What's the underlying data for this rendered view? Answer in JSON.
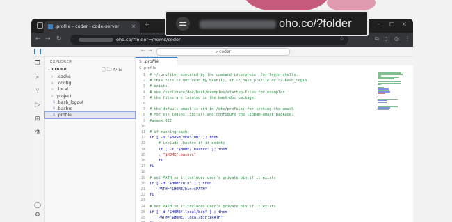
{
  "browser": {
    "tab_title": ".profile - coder - code-server",
    "tab_close": "×",
    "new_tab": "+",
    "url": "oho.co/?folder=/home/coder",
    "window_controls": [
      "–",
      "□",
      "×"
    ],
    "toolbar_icons": [
      "arrow-left-icon",
      "arrow-right-icon",
      "reload-icon",
      "tune-icon",
      "star-icon",
      "extensions-icon",
      "sidebar-icon",
      "profile-icon",
      "menu-icon"
    ]
  },
  "zoom_popup": {
    "url": "oho.co/?folder"
  },
  "vscode": {
    "command_center": "coder",
    "sidebar": {
      "header": "EXPLORER",
      "folder": "CODER",
      "items": [
        {
          "label": ".cache",
          "type": "folder"
        },
        {
          "label": ".config",
          "type": "folder"
        },
        {
          "label": ".local",
          "type": "folder"
        },
        {
          "label": "project",
          "type": "folder"
        },
        {
          "label": ".bash_logout",
          "type": "file"
        },
        {
          "label": ".bashrc",
          "type": "file"
        },
        {
          "label": ".profile",
          "type": "file",
          "selected": true
        }
      ]
    },
    "editor": {
      "tab_label": ".profile",
      "breadcrumb": ".profile",
      "lines": [
        {
          "n": "1",
          "t": "# ~/.profile: executed by the command interpreter for login shells.",
          "k": "comment"
        },
        {
          "n": "2",
          "t": "# This file is not read by bash(1), if ~/.bash_profile or ~/.bash_login",
          "k": "comment"
        },
        {
          "n": "3",
          "t": "# exists.",
          "k": "comment"
        },
        {
          "n": "4",
          "t": "# see /usr/share/doc/bash/examples/startup-files for examples.",
          "k": "comment"
        },
        {
          "n": "5",
          "t": "# the files are located in the bash-doc package.",
          "k": "comment"
        },
        {
          "n": "6",
          "t": "",
          "k": "plain"
        },
        {
          "n": "7",
          "t": "# the default umask is set in /etc/profile; for setting the umask",
          "k": "comment"
        },
        {
          "n": "8",
          "t": "# for ssh logins, install and configure the libpam-umask package.",
          "k": "comment"
        },
        {
          "n": "9",
          "t": "#umask 022",
          "k": "comment"
        },
        {
          "n": "10",
          "t": "",
          "k": "plain"
        },
        {
          "n": "11",
          "t": "# if running bash",
          "k": "comment"
        },
        {
          "n": "12",
          "t": "if [ -n \"$BASH_VERSION\" ]; then",
          "k": "kw"
        },
        {
          "n": "13",
          "t": "    # include .bashrc if it exists",
          "k": "comment"
        },
        {
          "n": "14",
          "t": "    if [ -f \"$HOME/.bashrc\" ]; then",
          "k": "kw"
        },
        {
          "n": "15",
          "t": "    . \"$HOME/.bashrc\"",
          "k": "str"
        },
        {
          "n": "16",
          "t": "    fi",
          "k": "kw"
        },
        {
          "n": "17",
          "t": "fi",
          "k": "kw"
        },
        {
          "n": "18",
          "t": "",
          "k": "plain"
        },
        {
          "n": "19",
          "t": "# set PATH so it includes user's private bin if it exists",
          "k": "comment"
        },
        {
          "n": "20",
          "t": "if [ -d \"$HOME/bin\" ] ; then",
          "k": "kw"
        },
        {
          "n": "21",
          "t": "    PATH=\"$HOME/bin:$PATH\"",
          "k": "var"
        },
        {
          "n": "22",
          "t": "fi",
          "k": "kw"
        },
        {
          "n": "23",
          "t": "",
          "k": "plain"
        },
        {
          "n": "24",
          "t": "# set PATH so it includes user's private bin if it exists",
          "k": "comment"
        },
        {
          "n": "25",
          "t": "if [ -d \"$HOME/.local/bin\" ] ; then",
          "k": "kw"
        },
        {
          "n": "26",
          "t": "    PATH=\"$HOME/.local/bin:$PATH\"",
          "k": "var"
        },
        {
          "n": "27",
          "t": "fi",
          "k": "kw"
        }
      ]
    }
  }
}
